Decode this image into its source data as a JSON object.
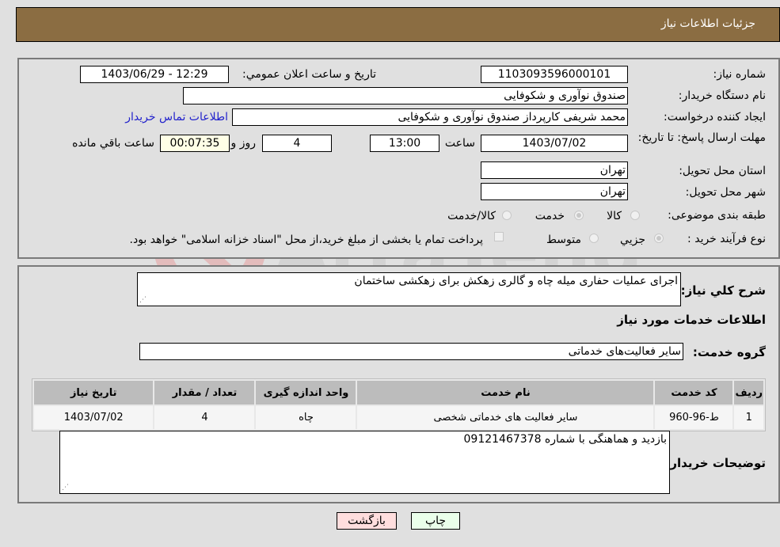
{
  "header": {
    "title": "جزئیات اطلاعات نیاز"
  },
  "form": {
    "need_number": {
      "label": "شماره نیاز:",
      "value": "1103093596000101"
    },
    "announce_datetime": {
      "label": "تاریخ و ساعت اعلان عمومي:",
      "value": "1403/06/29 - 12:29"
    },
    "buyer_org": {
      "label": "نام دستگاه خریدار:",
      "value": "صندوق نوآوری و شکوفایی"
    },
    "requester": {
      "label": "ایجاد کننده درخواست:",
      "value": "محمد  شریفی کارپرداز صندوق نوآوری و شکوفایی"
    },
    "buyer_contact_link": "اطلاعات تماس خریدار",
    "deadline": {
      "label": "مهلت ارسال پاسخ: تا تاریخ:",
      "date": "1403/07/02",
      "time_label": "ساعت",
      "time": "13:00",
      "days": "4",
      "days_label": "روز و",
      "remaining": "00:07:35",
      "remaining_label": "ساعت باقي مانده"
    },
    "province": {
      "label": "استان محل تحویل:",
      "value": "تهران"
    },
    "city": {
      "label": "شهر محل تحویل:",
      "value": "تهران"
    },
    "category": {
      "label": "طبقه بندی موضوعی:",
      "options": [
        {
          "label": "کالا",
          "checked": false
        },
        {
          "label": "خدمت",
          "checked": true
        },
        {
          "label": "کالا/خدمت",
          "checked": false
        }
      ]
    },
    "purchase_type": {
      "label": "نوع فرآیند خرید :",
      "options": [
        {
          "label": "جزیي",
          "checked": true
        },
        {
          "label": "متوسط",
          "checked": false
        }
      ],
      "treasury_note": "پرداخت تمام یا بخشی از مبلغ خرید،از محل \"اسناد خزانه اسلامی\" خواهد بود.",
      "treasury_checked": false
    }
  },
  "details": {
    "general_desc_label": "شرح کلي نیاز:",
    "general_desc": "اجرای عملیات حفاری میله چاه و گالری زهکش برای زهکشی ساختمان",
    "services_heading": "اطلاعات خدمات مورد نیاز",
    "service_group_label": "گروه خدمت:",
    "service_group": "سایر فعالیت‌های خدماتی",
    "table": {
      "headers": [
        "ردیف",
        "کد خدمت",
        "نام خدمت",
        "واحد اندازه گیری",
        "تعداد / مقدار",
        "تاریخ نیاز"
      ],
      "rows": [
        [
          "1",
          "ط-96-960",
          "سایر فعالیت های خدماتی شخصی",
          "چاه",
          "4",
          "1403/07/02"
        ]
      ]
    },
    "buyer_notes_label": "توضیحات خریدار:",
    "buyer_notes": "بازدید و هماهنگی با شماره 09121467378"
  },
  "buttons": {
    "print": "چاپ",
    "back": "بازگشت"
  },
  "colors": {
    "header_bg": "#8b6d42",
    "print_bg": "#eaffea",
    "back_bg": "#ffdede",
    "link": "#2222cc"
  }
}
